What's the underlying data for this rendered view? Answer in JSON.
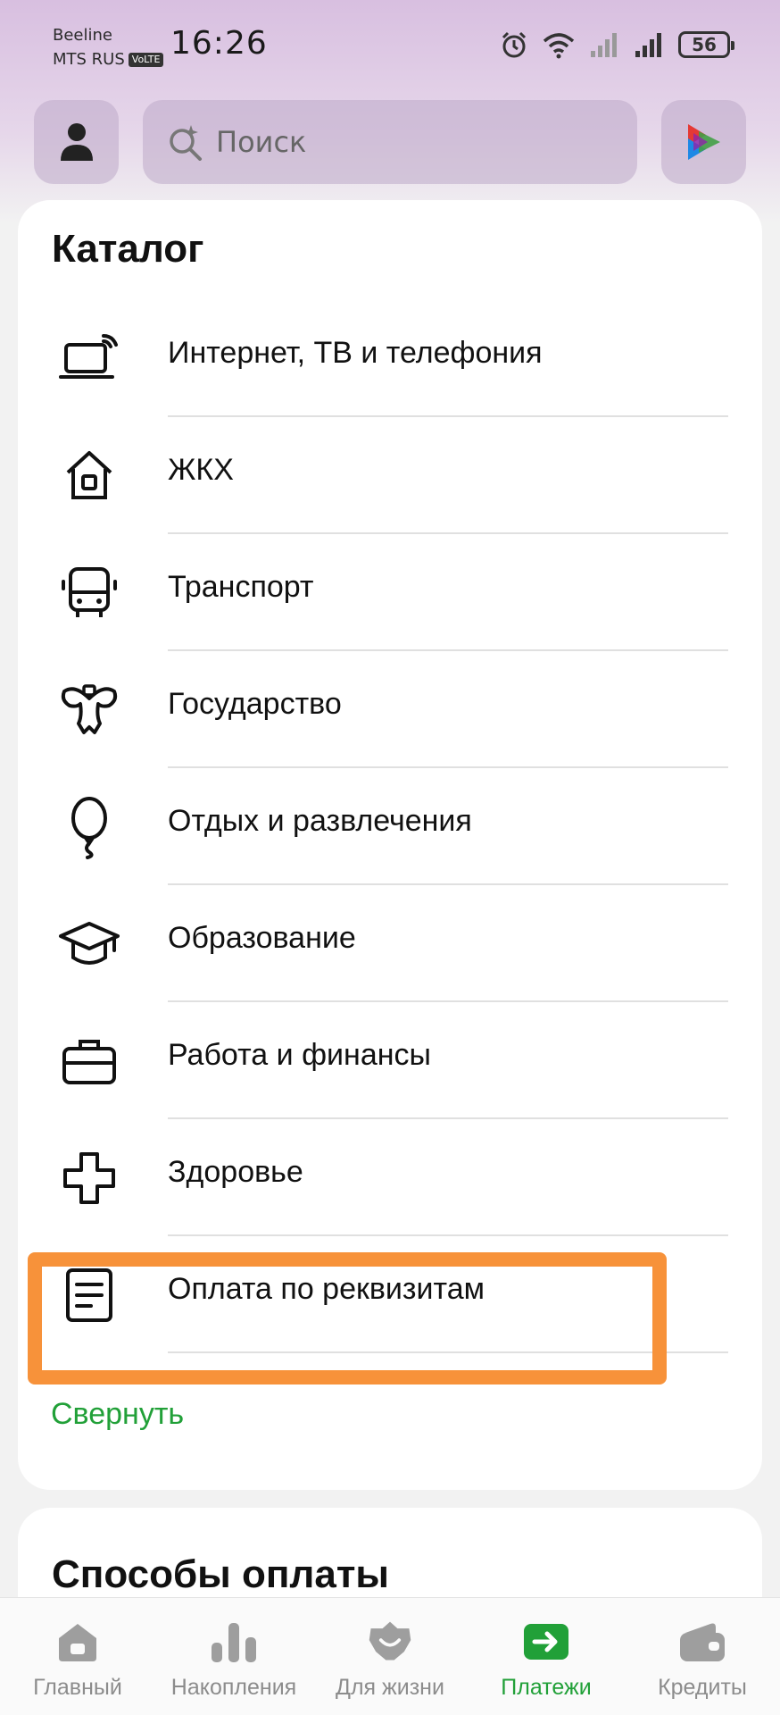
{
  "status_bar": {
    "carrier_1": "Beeline",
    "carrier_2": "MTS RUS",
    "volte": "VoLTE",
    "time": "16:26",
    "battery": "56"
  },
  "header": {
    "search_placeholder": "Поиск"
  },
  "catalog": {
    "title": "Каталог",
    "items": [
      {
        "label": "Интернет, ТВ и телефония",
        "icon": "laptop-signal-icon"
      },
      {
        "label": "ЖКХ",
        "icon": "house-icon"
      },
      {
        "label": "Транспорт",
        "icon": "bus-icon"
      },
      {
        "label": "Государство",
        "icon": "emblem-icon"
      },
      {
        "label": "Отдых и развлечения",
        "icon": "balloon-icon"
      },
      {
        "label": "Образование",
        "icon": "graduation-cap-icon"
      },
      {
        "label": "Работа и финансы",
        "icon": "briefcase-icon"
      },
      {
        "label": "Здоровье",
        "icon": "cross-icon"
      },
      {
        "label": "Оплата по реквизитам",
        "icon": "document-icon"
      }
    ],
    "collapse_label": "Свернуть"
  },
  "payment_methods": {
    "title": "Способы оплаты"
  },
  "bottom_nav": {
    "items": [
      {
        "label": "Главный",
        "icon": "home-icon"
      },
      {
        "label": "Накопления",
        "icon": "chart-icon"
      },
      {
        "label": "Для жизни",
        "icon": "smile-star-icon"
      },
      {
        "label": "Платежи",
        "icon": "payment-arrow-icon"
      },
      {
        "label": "Кредиты",
        "icon": "wallet-icon"
      }
    ],
    "active_index": 3
  },
  "colors": {
    "accent_green": "#21a038",
    "highlight_orange": "#f7923a"
  }
}
